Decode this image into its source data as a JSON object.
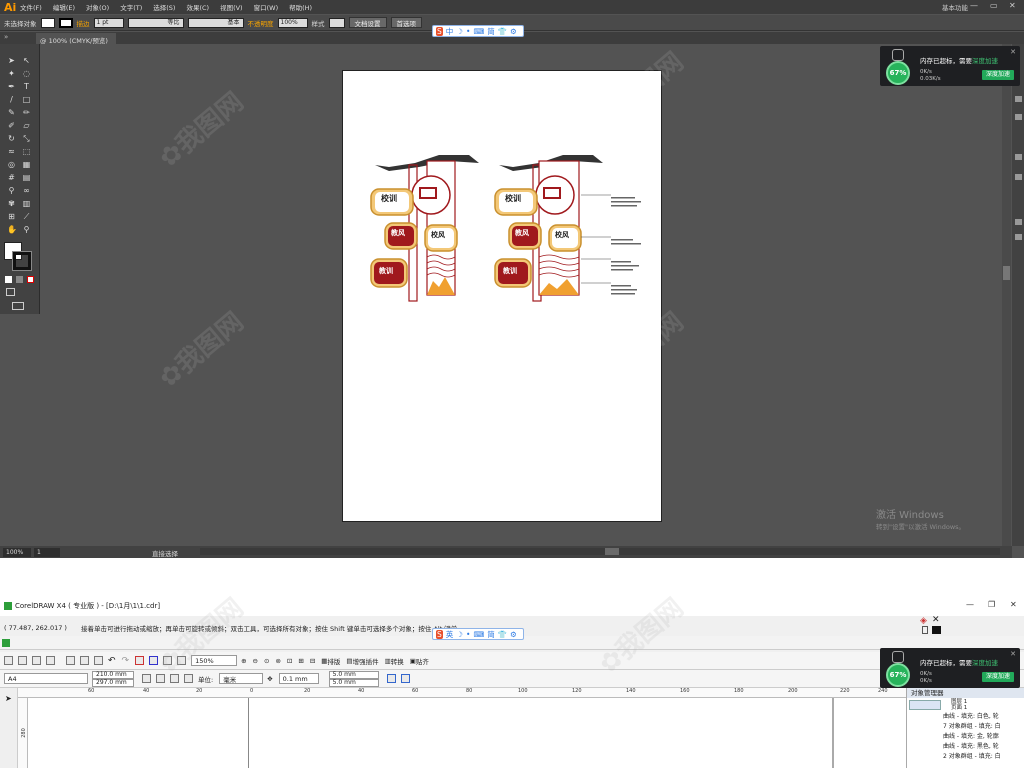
{
  "illustrator": {
    "logo": "Ai",
    "menu": [
      "文件(F)",
      "编辑(E)",
      "对象(O)",
      "文字(T)",
      "选择(S)",
      "效果(C)",
      "视图(V)",
      "窗口(W)",
      "帮助(H)"
    ],
    "workspace": "基本功能",
    "control": {
      "no_selection": "未选择对象",
      "stroke_label": "描边",
      "stroke_weight": "1 pt",
      "profile1": "等比",
      "profile2": "基本",
      "opacity_label": "不透明度",
      "opacity_value": "100%",
      "style_label": "样式",
      "doc_setup": "文档设置",
      "preferences": "首选项"
    },
    "doc_tab": "@ 100% (CMYK/预览)",
    "status": {
      "zoom": "100%",
      "artboard": "1",
      "mode": "直接选择"
    },
    "activation": {
      "title": "激活 Windows",
      "subtitle": "转到\"设置\"以激活 Windows。"
    },
    "artwork": {
      "labels_a": [
        "校训",
        "教风",
        "校风",
        "教训"
      ],
      "labels_b": [
        "校训",
        "教风",
        "校风",
        "教训"
      ]
    }
  },
  "popup": {
    "title": "内存已超标，需要",
    "link": "深度加速",
    "percent": "67%",
    "net_up": "0K/s",
    "net_down": "0.03K/s",
    "net_down_b": "0K/s",
    "button": "深度加速"
  },
  "ime": {
    "top": [
      "中",
      "•",
      "简"
    ],
    "bottom": [
      "英",
      "•",
      "简"
    ]
  },
  "coreldraw": {
    "title": "CorelDRAW X4 ( 专业版 ) - [D:\\1月\\1\\1.cdr]",
    "coord": "( 77.487, 262.017 )",
    "hint": "接着单击可进行拖动或缩放；再单击可旋转或倾斜；双击工具，可选择所有对象；按住 Shift 键单击可选择多个对象；按住 Alt 键单",
    "toolbar": {
      "zoom": "150%",
      "arrange": "排版",
      "plugin": "增强插件",
      "convert": "转换",
      "paste": "贴齐"
    },
    "property": {
      "paper": "A4",
      "width": "210.0 mm",
      "height": "297.0 mm",
      "unit_label": "单位:",
      "unit": "毫米",
      "nudge": "0.1 mm",
      "dup_x": "5.0 mm",
      "dup_y": "5.0 mm"
    },
    "ruler_labels": [
      "60",
      "40",
      "20",
      "0",
      "20",
      "40",
      "60",
      "80",
      "100",
      "120",
      "140",
      "160",
      "180",
      "200",
      "220",
      "240"
    ],
    "vruler_label": "280",
    "object_manager": {
      "title": "对象管理器",
      "tree": [
        "图层 1",
        "页面 1"
      ],
      "rows": [
        "曲线 - 填充: 白色, 轮",
        "7 对象群组 - 填充: 白",
        "曲线 - 填充: 金, 轮廓",
        "曲线 - 填充: 黑色, 轮",
        "2 对象群组 - 填充: 白"
      ]
    }
  }
}
